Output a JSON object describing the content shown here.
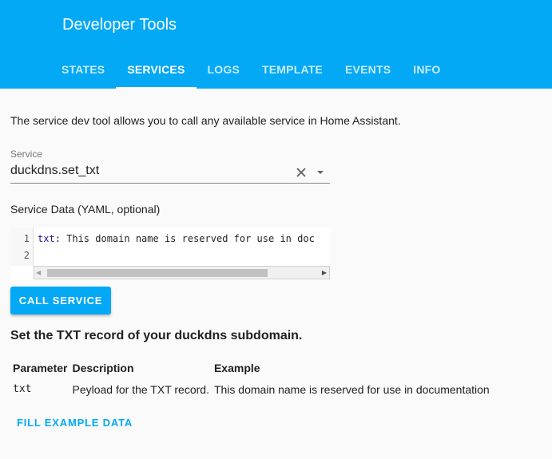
{
  "header": {
    "title": "Developer Tools",
    "tabs": [
      {
        "label": "STATES",
        "active": false
      },
      {
        "label": "SERVICES",
        "active": true
      },
      {
        "label": "LOGS",
        "active": false
      },
      {
        "label": "TEMPLATE",
        "active": false
      },
      {
        "label": "EVENTS",
        "active": false
      },
      {
        "label": "INFO",
        "active": false
      }
    ]
  },
  "intro": "The service dev tool allows you to call any available service in Home Assistant.",
  "service": {
    "label": "Service",
    "value": "duckdns.set_txt",
    "clear_icon": "close-icon",
    "dropdown_icon": "arrow-drop-down-icon"
  },
  "service_data": {
    "label": "Service Data (YAML, optional)",
    "lines": [
      {
        "number": "1",
        "key": "txt",
        "rest": ": This domain name is reserved for use in doc"
      },
      {
        "number": "2",
        "key": "",
        "rest": ""
      }
    ]
  },
  "call_button": "CALL SERVICE",
  "description": "Set the TXT record of your duckdns subdomain.",
  "table": {
    "headers": [
      "Parameter",
      "Description",
      "Example"
    ],
    "rows": [
      [
        "txt",
        "Peyload for the TXT record.",
        "This domain name is reserved for use in documentation"
      ]
    ]
  },
  "fill_example": "FILL EXAMPLE DATA",
  "colors": {
    "primary": "#03a9f4",
    "background": "#fafafa"
  }
}
